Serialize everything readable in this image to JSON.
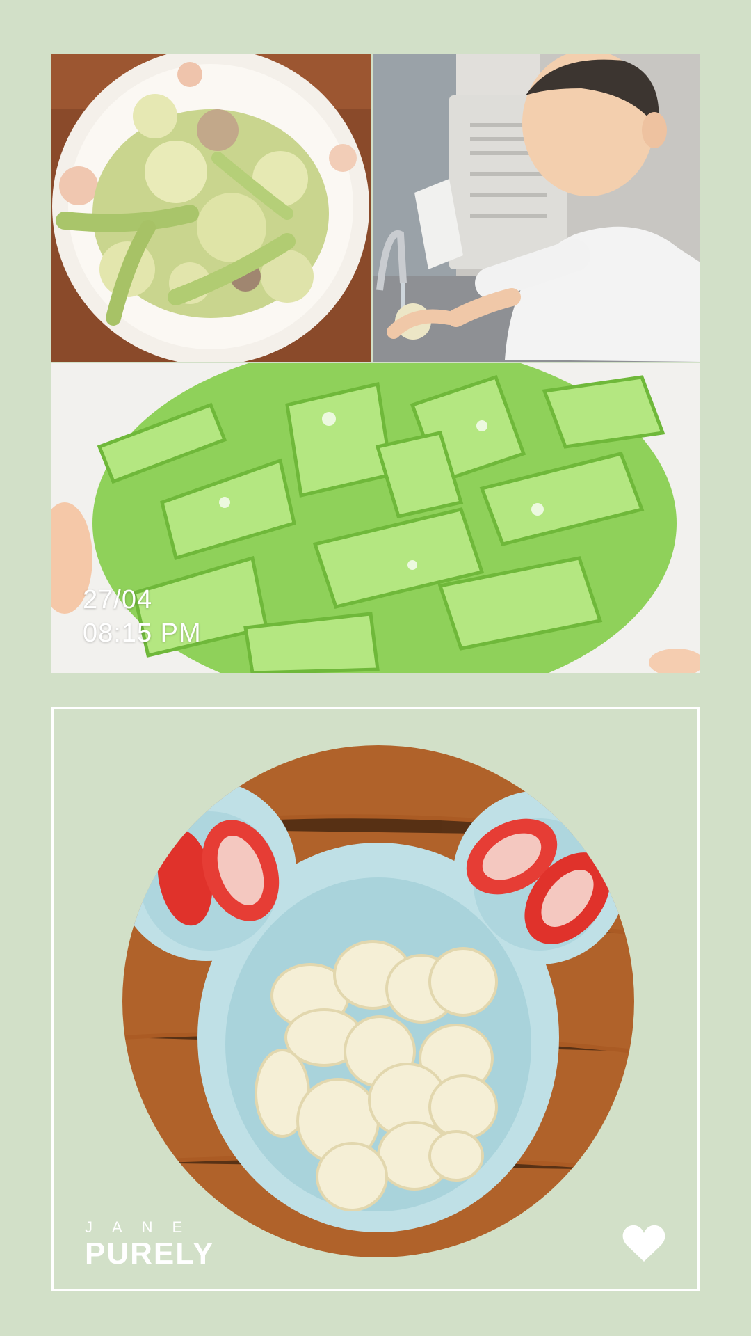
{
  "overlay": {
    "date": "27/04",
    "time": "08:15 PM"
  },
  "brand": {
    "top": "JANE",
    "bottom": "PURELY"
  },
  "icons": {
    "like": "heart-icon"
  },
  "colors": {
    "background": "#d2e0c8",
    "frame": "#ffffff"
  }
}
